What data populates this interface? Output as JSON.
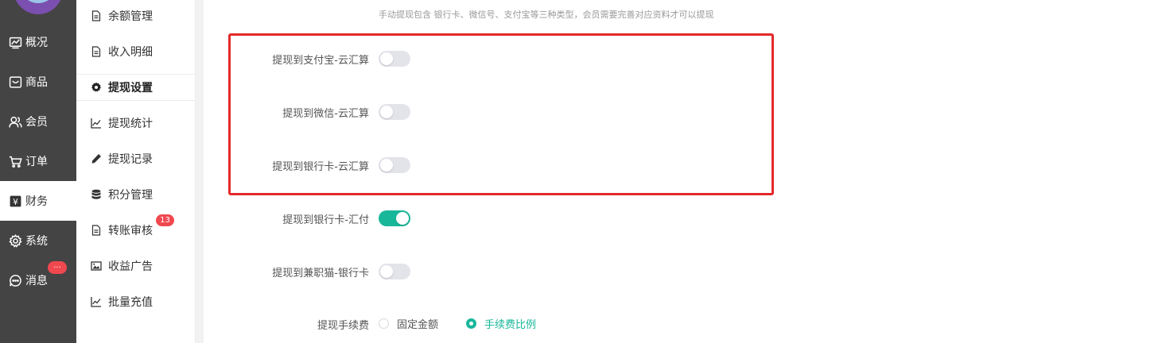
{
  "primary_nav": {
    "items": [
      {
        "label": "概况",
        "icon": "chart-icon"
      },
      {
        "label": "商品",
        "icon": "shop-icon"
      },
      {
        "label": "会员",
        "icon": "users-icon"
      },
      {
        "label": "订单",
        "icon": "cart-icon"
      },
      {
        "label": "财务",
        "icon": "finance-icon",
        "active": true
      },
      {
        "label": "系统",
        "icon": "gear-icon"
      },
      {
        "label": "消息",
        "icon": "chat-icon"
      }
    ],
    "message_badge": "..."
  },
  "secondary_nav": {
    "items": [
      {
        "label": "余额管理",
        "icon": "document-icon"
      },
      {
        "label": "收入明细",
        "icon": "document-icon"
      },
      {
        "label": "提现设置",
        "icon": "gear-icon",
        "active": true
      },
      {
        "label": "提现统计",
        "icon": "line-chart-icon"
      },
      {
        "label": "提现记录",
        "icon": "pencil-icon"
      },
      {
        "label": "积分管理",
        "icon": "database-icon"
      },
      {
        "label": "转账审核",
        "icon": "document-icon"
      },
      {
        "label": "收益广告",
        "icon": "image-icon"
      },
      {
        "label": "批量充值",
        "icon": "line-chart-icon"
      }
    ],
    "transfer_badge": "13"
  },
  "main": {
    "hint": "手动提现包含 银行卡、微信号、支付宝等三种类型，会员需要完善对应资料才可以提现",
    "settings": [
      {
        "label": "提现到支付宝-云汇算",
        "enabled": false
      },
      {
        "label": "提现到微信-云汇算",
        "enabled": false
      },
      {
        "label": "提现到银行卡-云汇算",
        "enabled": false
      },
      {
        "label": "提现到银行卡-汇付",
        "enabled": true
      },
      {
        "label": "提现到兼职猫-银行卡",
        "enabled": false
      }
    ],
    "fee": {
      "label": "提现手续费",
      "options": [
        {
          "label": "固定金额",
          "checked": false
        },
        {
          "label": "手续费比例",
          "checked": true
        }
      ]
    }
  },
  "colors": {
    "accent": "#19b79a",
    "highlight_border": "#e4292a",
    "badge": "#f0484f",
    "sidebar": "#444444"
  }
}
